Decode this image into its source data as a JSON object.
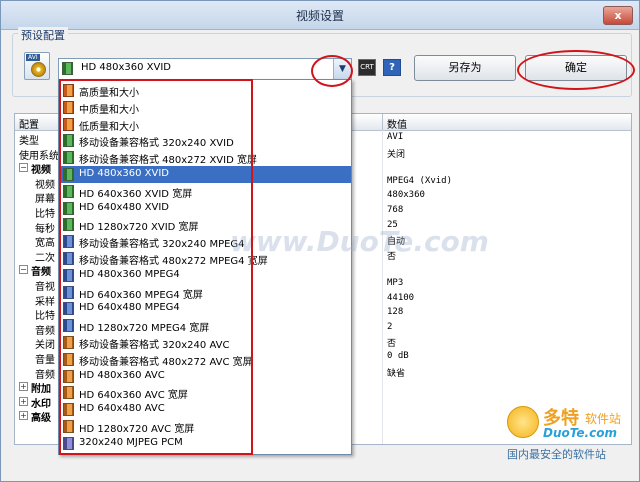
{
  "window": {
    "title": "视频设置",
    "close_label": "x"
  },
  "preset": {
    "group_label": "预设配置",
    "icon_tag": "AVI",
    "selected": "HD 480x360 XVID",
    "saveas_label": "另存为",
    "ok_label": "确定",
    "help_label": "?",
    "lcd_label": "CRT"
  },
  "table": {
    "headers": {
      "name": "配置",
      "value": "数值"
    },
    "rows": [
      {
        "label": "类型",
        "value": "AVI",
        "indent": 0,
        "toggle": "",
        "bold": false
      },
      {
        "label": "使用系统",
        "value": "关闭",
        "indent": 0,
        "toggle": "",
        "bold": false
      },
      {
        "label": "视频",
        "value": "",
        "indent": 0,
        "toggle": "−",
        "bold": true
      },
      {
        "label": "视频",
        "value": "MPEG4 (Xvid)",
        "indent": 1,
        "toggle": "",
        "bold": false
      },
      {
        "label": "屏幕",
        "value": "480x360",
        "indent": 1,
        "toggle": "",
        "bold": false
      },
      {
        "label": "比特",
        "value": "768",
        "indent": 1,
        "toggle": "",
        "bold": false
      },
      {
        "label": "每秒",
        "value": "25",
        "indent": 1,
        "toggle": "",
        "bold": false
      },
      {
        "label": "宽高",
        "value": "自动",
        "indent": 1,
        "toggle": "",
        "bold": false
      },
      {
        "label": "二次",
        "value": "否",
        "indent": 1,
        "toggle": "",
        "bold": false
      },
      {
        "label": "音频",
        "value": "",
        "indent": 0,
        "toggle": "−",
        "bold": true
      },
      {
        "label": "音视",
        "value": "MP3",
        "indent": 1,
        "toggle": "",
        "bold": false
      },
      {
        "label": "采样",
        "value": "44100",
        "indent": 1,
        "toggle": "",
        "bold": false
      },
      {
        "label": "比特",
        "value": "128",
        "indent": 1,
        "toggle": "",
        "bold": false
      },
      {
        "label": "音频",
        "value": "2",
        "indent": 1,
        "toggle": "",
        "bold": false
      },
      {
        "label": "关闭",
        "value": "否",
        "indent": 1,
        "toggle": "",
        "bold": false
      },
      {
        "label": "音量",
        "value": "0 dB",
        "indent": 1,
        "toggle": "",
        "bold": false
      },
      {
        "label": "音频",
        "value": "缺省",
        "indent": 1,
        "toggle": "",
        "bold": false
      },
      {
        "label": "附加",
        "value": "",
        "indent": 0,
        "toggle": "+",
        "bold": true
      },
      {
        "label": "水印",
        "value": "",
        "indent": 0,
        "toggle": "+",
        "bold": true
      },
      {
        "label": "高级",
        "value": "",
        "indent": 0,
        "toggle": "+",
        "bold": true
      }
    ]
  },
  "dropdown": {
    "items": [
      {
        "label": "高质量和大小",
        "icon": "qual"
      },
      {
        "label": "中质量和大小",
        "icon": "qual"
      },
      {
        "label": "低质量和大小",
        "icon": "qual"
      },
      {
        "label": "移动设备兼容格式 320x240 XVID",
        "icon": "xvid"
      },
      {
        "label": "移动设备兼容格式 480x272 XVID 宽屏",
        "icon": "xvid"
      },
      {
        "label": "HD 480x360 XVID",
        "icon": "xvid",
        "selected": true
      },
      {
        "label": "HD 640x360 XVID 宽屏",
        "icon": "xvid"
      },
      {
        "label": "HD 640x480 XVID",
        "icon": "xvid"
      },
      {
        "label": "HD 1280x720 XVID 宽屏",
        "icon": "xvid"
      },
      {
        "label": "移动设备兼容格式 320x240 MPEG4",
        "icon": "mp4"
      },
      {
        "label": "移动设备兼容格式 480x272 MPEG4 宽屏",
        "icon": "mp4"
      },
      {
        "label": "HD 480x360 MPEG4",
        "icon": "mp4"
      },
      {
        "label": "HD 640x360 MPEG4 宽屏",
        "icon": "mp4"
      },
      {
        "label": "HD 640x480 MPEG4",
        "icon": "mp4"
      },
      {
        "label": "HD 1280x720 MPEG4 宽屏",
        "icon": "mp4"
      },
      {
        "label": "移动设备兼容格式 320x240 AVC",
        "icon": "avc"
      },
      {
        "label": "移动设备兼容格式 480x272 AVC 宽屏",
        "icon": "avc"
      },
      {
        "label": "HD 480x360 AVC",
        "icon": "avc"
      },
      {
        "label": "HD 640x360 AVC 宽屏",
        "icon": "avc"
      },
      {
        "label": "HD 640x480 AVC",
        "icon": "avc"
      },
      {
        "label": "HD 1280x720 AVC 宽屏",
        "icon": "avc"
      },
      {
        "label": "320x240 MJPEG PCM",
        "icon": "mj"
      }
    ]
  },
  "watermark": {
    "text": "www.DuoTe.com"
  },
  "logo": {
    "brand": "多特",
    "soft": "软件站",
    "site": "DuoTe.com",
    "slogan": "国内最安全的软件站"
  },
  "colors": {
    "annotation_red": "#d0141a",
    "selection_blue": "#3a6fc4"
  }
}
